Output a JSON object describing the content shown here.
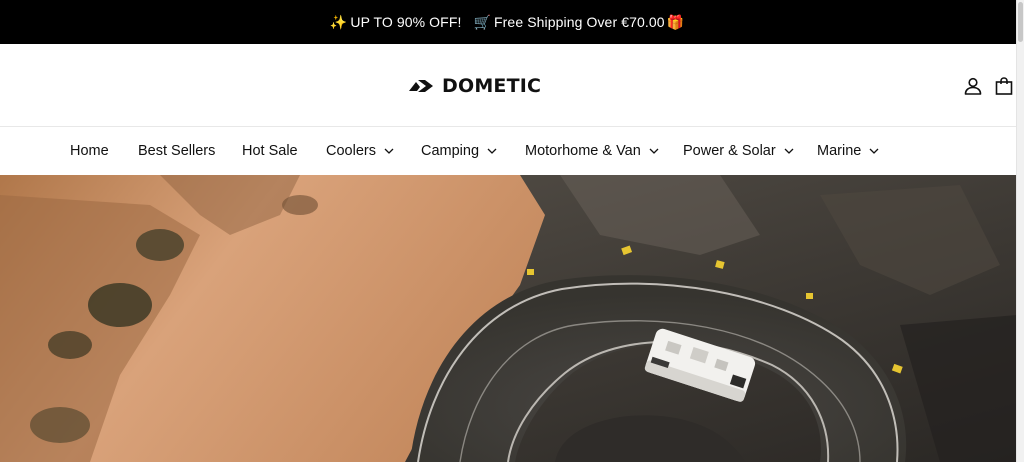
{
  "announcement": {
    "part1_icon": "sparkles-icon",
    "part1_text": "UP TO 90% OFF!",
    "part2_icon": "truck-icon",
    "part2_text": "Free Shipping Over €70.00",
    "part3_icon": "gift-icon"
  },
  "header": {
    "logo_text": "DOMETIC",
    "account_icon": "user-icon",
    "cart_icon": "shopping-bag-icon"
  },
  "nav": {
    "items": [
      {
        "label": "Home",
        "has_dropdown": false
      },
      {
        "label": "Best Sellers",
        "has_dropdown": false
      },
      {
        "label": "Hot Sale",
        "has_dropdown": false
      },
      {
        "label": "Coolers",
        "has_dropdown": true
      },
      {
        "label": "Camping",
        "has_dropdown": true
      },
      {
        "label": "Motorhome & Van",
        "has_dropdown": true
      },
      {
        "label": "Power & Solar",
        "has_dropdown": true
      },
      {
        "label": "Marine",
        "has_dropdown": true
      }
    ]
  },
  "colors": {
    "announcement_bg": "#000000",
    "announcement_text": "#ffffff",
    "header_bg": "#ffffff",
    "text": "#111111"
  }
}
